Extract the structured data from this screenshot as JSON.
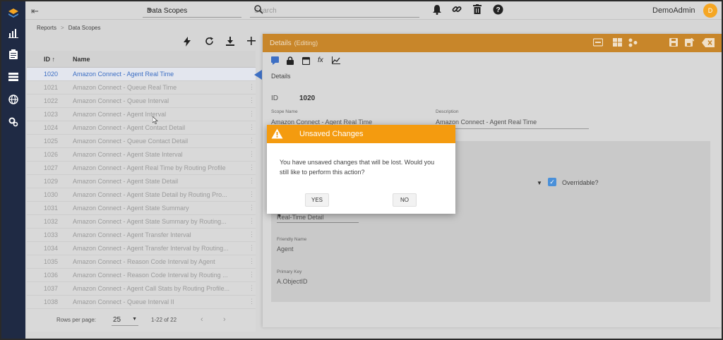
{
  "topbar": {
    "scope_select": "Data Scopes",
    "search_placeholder": "Search",
    "user_name": "DemoAdmin",
    "avatar_initial": "D"
  },
  "breadcrumb": {
    "root": "Reports",
    "sep": ">",
    "current": "Data Scopes"
  },
  "list": {
    "col_id": "ID",
    "col_name": "Name",
    "rows": [
      {
        "id": "1020",
        "name": "Amazon Connect - Agent Real Time",
        "selected": true
      },
      {
        "id": "1021",
        "name": "Amazon Connect - Queue Real Time"
      },
      {
        "id": "1022",
        "name": "Amazon Connect - Queue Interval"
      },
      {
        "id": "1023",
        "name": "Amazon Connect - Agent Interval"
      },
      {
        "id": "1024",
        "name": "Amazon Connect - Agent Contact Detail"
      },
      {
        "id": "1025",
        "name": "Amazon Connect - Queue Contact Detail"
      },
      {
        "id": "1026",
        "name": "Amazon Connect - Agent State Interval"
      },
      {
        "id": "1027",
        "name": "Amazon Connect - Agent Real Time by Routing Profile"
      },
      {
        "id": "1029",
        "name": "Amazon Connect - Agent State Detail"
      },
      {
        "id": "1030",
        "name": "Amazon Connect - Agent State Detail by Routing Pro..."
      },
      {
        "id": "1031",
        "name": "Amazon Connect - Agent State Summary"
      },
      {
        "id": "1032",
        "name": "Amazon Connect - Agent State Summary by Routing..."
      },
      {
        "id": "1033",
        "name": "Amazon Connect - Agent Transfer Interval"
      },
      {
        "id": "1034",
        "name": "Amazon Connect - Agent Transfer Interval by Routing..."
      },
      {
        "id": "1035",
        "name": "Amazon Connect - Reason Code Interval by Agent"
      },
      {
        "id": "1036",
        "name": "Amazon Connect - Reason Code Interval by Routing ..."
      },
      {
        "id": "1037",
        "name": "Amazon Connect - Agent Call Stats by Routing Profile..."
      },
      {
        "id": "1038",
        "name": "Amazon Connect - Queue Interval II"
      }
    ],
    "rows_per_page_label": "Rows per page:",
    "rows_per_page": "25",
    "range": "1-22 of 22"
  },
  "detail": {
    "title": "Details",
    "mode": "(Editing)",
    "section_title": "Details",
    "id_label": "ID",
    "id_value": "1020",
    "scope_name_label": "Scope Name",
    "scope_name_value": "Amazon Connect - Agent Real Time",
    "description_label": "Description",
    "description_value": "Amazon Connect - Agent Real Time",
    "overridable_label": "Overridable?",
    "type_value": "Real-Time Detail",
    "friendly_name_label": "Friendly Name",
    "friendly_name_value": "Agent",
    "primary_key_label": "Primary Key",
    "primary_key_value": "A.ObjectID"
  },
  "modal": {
    "title": "Unsaved Changes",
    "message": "You have unsaved changes that will be lost. Would you still like to perform this action?",
    "yes_label": "YES",
    "no_label": "NO"
  },
  "colors": {
    "rail": "#1f2a44",
    "detail_header": "#c8862a",
    "modal_header": "#f49b0f",
    "accent_blue": "#3d6fc4",
    "avatar": "#f5a623"
  }
}
